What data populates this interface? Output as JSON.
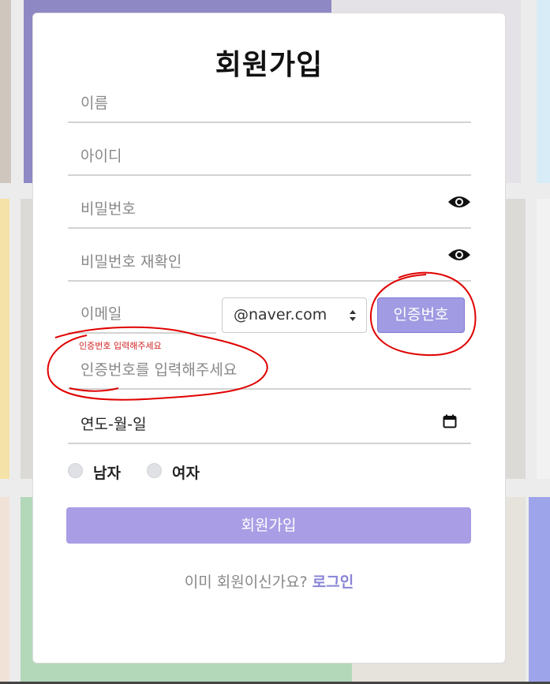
{
  "form": {
    "title": "회원가입",
    "name_placeholder": "이름",
    "id_placeholder": "아이디",
    "password_placeholder": "비밀번호",
    "password_confirm_placeholder": "비밀번호 재확인",
    "email_placeholder": "이메일",
    "email_domain_selected": "@naver.com",
    "verify_button": "인증번호",
    "verify_error": "인증번호 입력해주세요",
    "verify_code_placeholder": "인증번호를 입력해주세요",
    "date_placeholder": "연도-월-일",
    "gender_male": "남자",
    "gender_female": "여자",
    "submit_button": "회원가입",
    "login_prompt": "이미 회원이신가요?",
    "login_link": "로그인"
  },
  "colors": {
    "accent": "#a99ee5",
    "button_verify": "#a09be2",
    "link": "#8a84d6",
    "error": "#d12323",
    "annotation": "#e00000"
  },
  "icons": [
    "eye-icon",
    "calendar-icon",
    "select-arrows-icon"
  ]
}
